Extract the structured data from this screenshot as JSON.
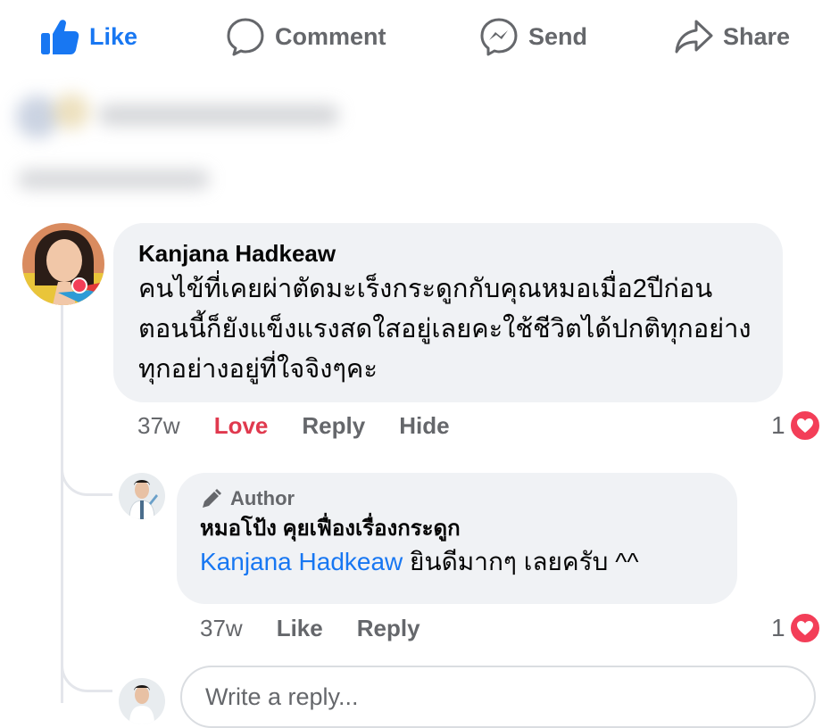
{
  "actions": {
    "like": "Like",
    "comment": "Comment",
    "send": "Send",
    "share": "Share"
  },
  "comment": {
    "author": "Kanjana Hadkeaw",
    "text": "คนไข้ที่เคยผ่าตัดมะเร็งกระดูกกับคุณหมอเมื่อ2ปีก่อน ตอนนี้ก็ยังแข็งแรงสดใสอยู่เลยคะใช้ชีวิตได้ปกติทุกอย่าง ทุกอย่างอยู่ที่ใจจิงๆคะ",
    "time": "37w",
    "love": "Love",
    "reply": "Reply",
    "hide": "Hide",
    "reaction_count": "1"
  },
  "reply": {
    "badge": "Author",
    "author": "หมอโป้ง คุยเฟื่องเรื่องกระดูก",
    "mention": "Kanjana Hadkeaw",
    "text": " ยินดีมากๆ เลยครับ ^^",
    "time": "37w",
    "like": "Like",
    "reply": "Reply",
    "reaction_count": "1"
  },
  "reply_box": {
    "placeholder": "Write a reply..."
  },
  "colors": {
    "accent": "#1877f2",
    "love": "#e0394e",
    "muted": "#65676b",
    "bubble": "#f0f2f5"
  },
  "icons": [
    "thumbs-up-icon",
    "comment-icon",
    "messenger-icon",
    "share-icon",
    "heart-icon",
    "pen-icon"
  ]
}
